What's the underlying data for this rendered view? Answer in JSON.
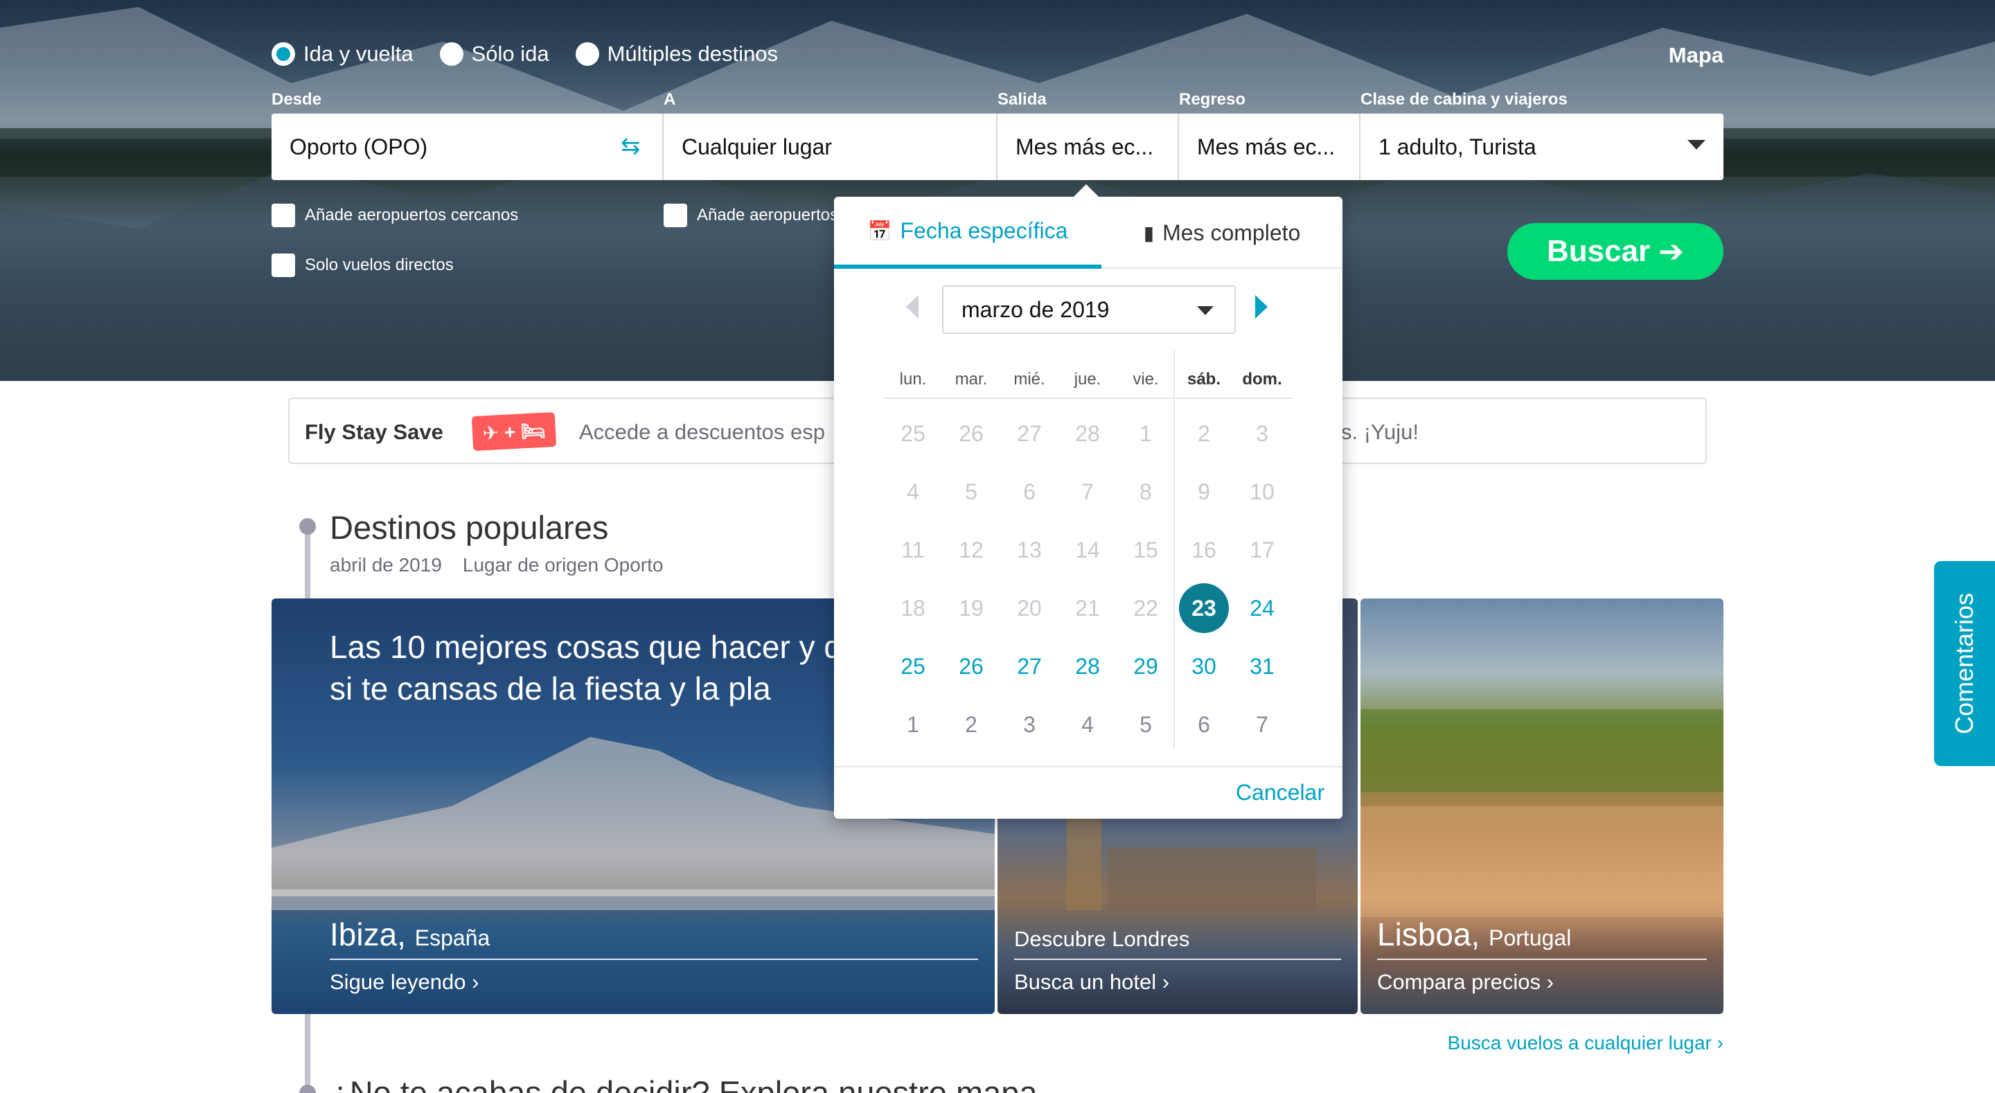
{
  "trip_types": [
    {
      "label": "Ida y vuelta",
      "selected": true
    },
    {
      "label": "Sólo ida",
      "selected": false
    },
    {
      "label": "Múltiples destinos",
      "selected": false
    }
  ],
  "map_link": "Mapa",
  "form": {
    "from_label": "Desde",
    "to_label": "A",
    "depart_label": "Salida",
    "return_label": "Regreso",
    "cabin_label": "Clase de cabina y viajeros",
    "from_value": "Oporto (OPO)",
    "to_value": "Cualquier lugar",
    "depart_value": "Mes más ec...",
    "return_value": "Mes más ec...",
    "cabin_value": "1 adulto, Turista",
    "nearby_from": "Añade aeropuertos cercanos",
    "nearby_to": "Añade aeropuertos cercanos",
    "direct_only": "Solo vuelos directos",
    "search_button": "Buscar"
  },
  "banner": {
    "brand": "Fly Stay Save",
    "badge": "✈ + 🛏",
    "text_left": "Accede a descuentos esp",
    "text_right": "s. ¡Yuju!"
  },
  "popular": {
    "title": "Destinos populares",
    "date": "abril de 2019",
    "origin": "Lugar de origen Oporto"
  },
  "cards": [
    {
      "headline": "Las 10 mejores cosas que hacer y q Ibiza, si te cansas de la fiesta y la pla",
      "city": "Ibiza,",
      "country": "España",
      "link": "Sigue leyendo"
    },
    {
      "city": "Descubre Londres",
      "link": "Busca un hotel"
    },
    {
      "city": "Lisboa,",
      "country": "Portugal",
      "link": "Compara precios"
    }
  ],
  "any_place_link": "Busca vuelos a cualquier lugar",
  "explore_title": "¿No te acabas de decidir? Explora nuestro mapa",
  "feedback": "Comentarios",
  "calendar": {
    "tab_specific": "Fecha específica",
    "tab_month": "Mes completo",
    "month": "marzo de 2019",
    "weekdays": [
      "lun.",
      "mar.",
      "mié.",
      "jue.",
      "vie.",
      "sáb.",
      "dom."
    ],
    "weeks": [
      [
        "25",
        "26",
        "27",
        "28",
        "1",
        "2",
        "3"
      ],
      [
        "4",
        "5",
        "6",
        "7",
        "8",
        "9",
        "10"
      ],
      [
        "11",
        "12",
        "13",
        "14",
        "15",
        "16",
        "17"
      ],
      [
        "18",
        "19",
        "20",
        "21",
        "22",
        "23",
        "24"
      ],
      [
        "25",
        "26",
        "27",
        "28",
        "29",
        "30",
        "31"
      ],
      [
        "1",
        "2",
        "3",
        "4",
        "5",
        "6",
        "7"
      ]
    ],
    "selected_day": "23",
    "cancel": "Cancelar"
  },
  "colors": {
    "accent": "#00a2c3",
    "search_green": "#00d775",
    "selected_day": "#0b7d93"
  }
}
